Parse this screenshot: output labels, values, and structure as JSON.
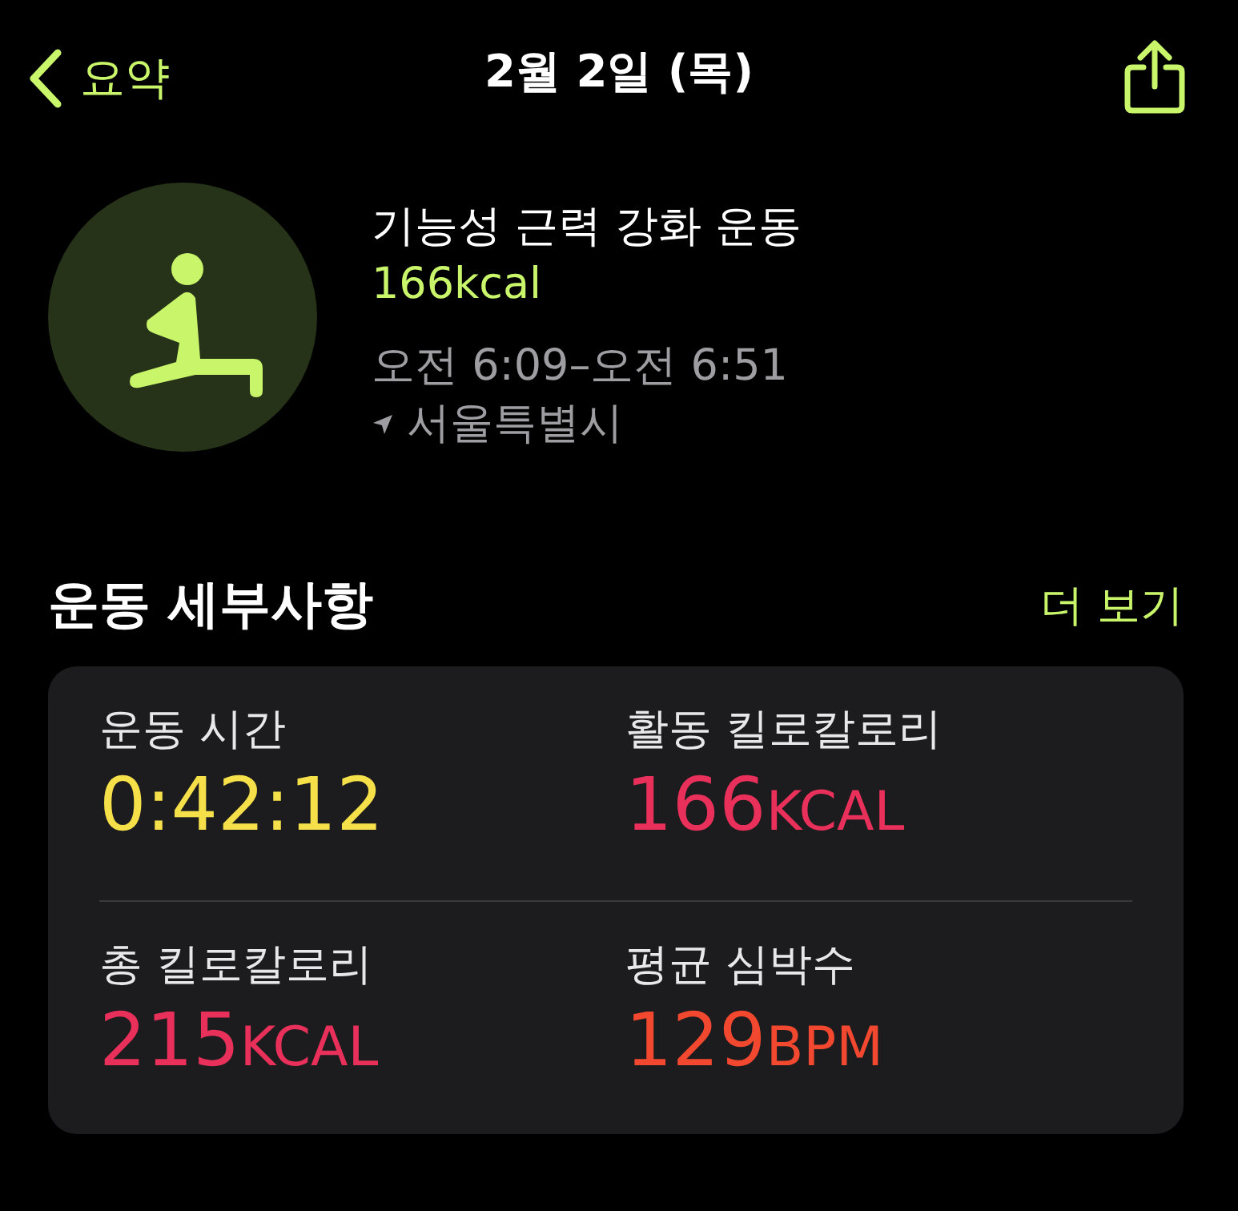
{
  "nav": {
    "back_label": "요약",
    "title": "2월 2일 (목)"
  },
  "workout": {
    "name": "기능성 근력 강화 운동",
    "calories": "166kcal",
    "time_range": "오전 6:09–오전 6:51",
    "location": "서울특별시"
  },
  "details": {
    "heading": "운동 세부사항",
    "more_link": "더 보기",
    "metrics": [
      {
        "label": "운동 시간",
        "value": "0:42:12",
        "color": "#f5e04a"
      },
      {
        "label": "활동 킬로칼로리",
        "value": "166",
        "unit": "KCAL",
        "color": "#e8305a"
      },
      {
        "label": "총 킬로칼로리",
        "value": "215",
        "unit": "KCAL",
        "color": "#e8305a"
      },
      {
        "label": "평균 심박수",
        "value": "129",
        "unit": "BPM",
        "color": "#f2482f"
      }
    ]
  }
}
